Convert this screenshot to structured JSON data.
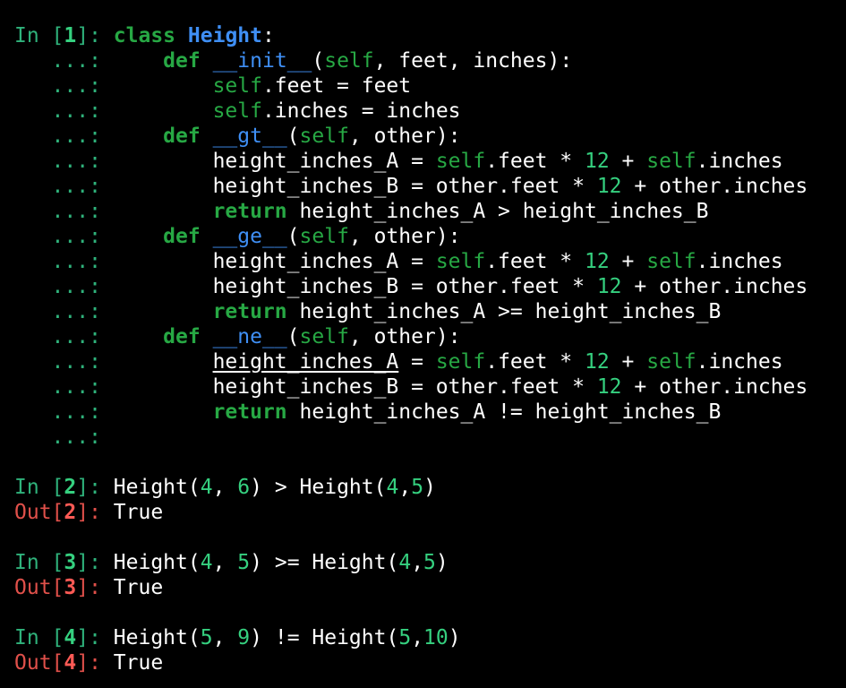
{
  "session": {
    "in_label": "In",
    "out_label": "Out",
    "continuation": "...:"
  },
  "cells": [
    {
      "number": "1",
      "input_lines": [
        {
          "indent": "",
          "tokens": [
            {
              "t": "class",
              "c": "kw"
            },
            {
              "t": " ",
              "c": "plain"
            },
            {
              "t": "Height",
              "c": "cls"
            },
            {
              "t": ":",
              "c": "plain"
            }
          ]
        },
        {
          "indent": "    ",
          "tokens": [
            {
              "t": "def",
              "c": "kw"
            },
            {
              "t": " ",
              "c": "plain"
            },
            {
              "t": "__init__",
              "c": "fn"
            },
            {
              "t": "(",
              "c": "plain"
            },
            {
              "t": "self",
              "c": "self"
            },
            {
              "t": ", feet, inches):",
              "c": "plain"
            }
          ]
        },
        {
          "indent": "        ",
          "tokens": [
            {
              "t": "self",
              "c": "self"
            },
            {
              "t": ".feet = feet",
              "c": "plain"
            }
          ]
        },
        {
          "indent": "        ",
          "tokens": [
            {
              "t": "self",
              "c": "self"
            },
            {
              "t": ".inches = inches",
              "c": "plain"
            }
          ]
        },
        {
          "indent": "    ",
          "tokens": [
            {
              "t": "def",
              "c": "kw"
            },
            {
              "t": " ",
              "c": "plain"
            },
            {
              "t": "__gt__",
              "c": "fn"
            },
            {
              "t": "(",
              "c": "plain"
            },
            {
              "t": "self",
              "c": "self"
            },
            {
              "t": ", other):",
              "c": "plain"
            }
          ]
        },
        {
          "indent": "        ",
          "tokens": [
            {
              "t": "height_inches_A = ",
              "c": "plain"
            },
            {
              "t": "self",
              "c": "self"
            },
            {
              "t": ".feet * ",
              "c": "plain"
            },
            {
              "t": "12",
              "c": "num"
            },
            {
              "t": " + ",
              "c": "plain"
            },
            {
              "t": "self",
              "c": "self"
            },
            {
              "t": ".inches",
              "c": "plain"
            }
          ]
        },
        {
          "indent": "        ",
          "tokens": [
            {
              "t": "height_inches_B = other.feet * ",
              "c": "plain"
            },
            {
              "t": "12",
              "c": "num"
            },
            {
              "t": " + other.inches",
              "c": "plain"
            }
          ]
        },
        {
          "indent": "        ",
          "tokens": [
            {
              "t": "return",
              "c": "kw"
            },
            {
              "t": " height_inches_A > height_inches_B",
              "c": "plain"
            }
          ]
        },
        {
          "indent": "    ",
          "tokens": [
            {
              "t": "def",
              "c": "kw"
            },
            {
              "t": " ",
              "c": "plain"
            },
            {
              "t": "__ge__",
              "c": "fn"
            },
            {
              "t": "(",
              "c": "plain"
            },
            {
              "t": "self",
              "c": "self"
            },
            {
              "t": ", other):",
              "c": "plain"
            }
          ]
        },
        {
          "indent": "        ",
          "tokens": [
            {
              "t": "height_inches_A = ",
              "c": "plain"
            },
            {
              "t": "self",
              "c": "self"
            },
            {
              "t": ".feet * ",
              "c": "plain"
            },
            {
              "t": "12",
              "c": "num"
            },
            {
              "t": " + ",
              "c": "plain"
            },
            {
              "t": "self",
              "c": "self"
            },
            {
              "t": ".inches",
              "c": "plain"
            }
          ]
        },
        {
          "indent": "        ",
          "tokens": [
            {
              "t": "height_inches_B = other.feet * ",
              "c": "plain"
            },
            {
              "t": "12",
              "c": "num"
            },
            {
              "t": " + other.inches",
              "c": "plain"
            }
          ]
        },
        {
          "indent": "        ",
          "tokens": [
            {
              "t": "return",
              "c": "kw"
            },
            {
              "t": " height_inches_A >= height_inches_B",
              "c": "plain"
            }
          ]
        },
        {
          "indent": "    ",
          "tokens": [
            {
              "t": "def",
              "c": "kw"
            },
            {
              "t": " ",
              "c": "plain"
            },
            {
              "t": "__ne__",
              "c": "fn"
            },
            {
              "t": "(",
              "c": "plain"
            },
            {
              "t": "self",
              "c": "self"
            },
            {
              "t": ", other):",
              "c": "plain"
            }
          ]
        },
        {
          "indent": "        ",
          "tokens": [
            {
              "t": "height_inches_A",
              "c": "underlined"
            },
            {
              "t": " = ",
              "c": "plain"
            },
            {
              "t": "self",
              "c": "self"
            },
            {
              "t": ".feet * ",
              "c": "plain"
            },
            {
              "t": "12",
              "c": "num"
            },
            {
              "t": " + ",
              "c": "plain"
            },
            {
              "t": "self",
              "c": "self"
            },
            {
              "t": ".inches",
              "c": "plain"
            }
          ]
        },
        {
          "indent": "        ",
          "tokens": [
            {
              "t": "height_inches_B = other.feet * ",
              "c": "plain"
            },
            {
              "t": "12",
              "c": "num"
            },
            {
              "t": " + other.inches",
              "c": "plain"
            }
          ]
        },
        {
          "indent": "        ",
          "tokens": [
            {
              "t": "return",
              "c": "kw"
            },
            {
              "t": " height_inches_A != height_inches_B",
              "c": "plain"
            }
          ]
        },
        {
          "indent": "",
          "tokens": []
        }
      ],
      "output": null
    },
    {
      "number": "2",
      "input_lines": [
        {
          "indent": "",
          "tokens": [
            {
              "t": "Height(",
              "c": "plain"
            },
            {
              "t": "4",
              "c": "num"
            },
            {
              "t": ", ",
              "c": "plain"
            },
            {
              "t": "6",
              "c": "num"
            },
            {
              "t": ") > Height(",
              "c": "plain"
            },
            {
              "t": "4",
              "c": "num"
            },
            {
              "t": ",",
              "c": "plain"
            },
            {
              "t": "5",
              "c": "num"
            },
            {
              "t": ")",
              "c": "plain"
            }
          ]
        }
      ],
      "output": "True"
    },
    {
      "number": "3",
      "input_lines": [
        {
          "indent": "",
          "tokens": [
            {
              "t": "Height(",
              "c": "plain"
            },
            {
              "t": "4",
              "c": "num"
            },
            {
              "t": ", ",
              "c": "plain"
            },
            {
              "t": "5",
              "c": "num"
            },
            {
              "t": ") >= Height(",
              "c": "plain"
            },
            {
              "t": "4",
              "c": "num"
            },
            {
              "t": ",",
              "c": "plain"
            },
            {
              "t": "5",
              "c": "num"
            },
            {
              "t": ")",
              "c": "plain"
            }
          ]
        }
      ],
      "output": "True"
    },
    {
      "number": "4",
      "input_lines": [
        {
          "indent": "",
          "tokens": [
            {
              "t": "Height(",
              "c": "plain"
            },
            {
              "t": "5",
              "c": "num"
            },
            {
              "t": ", ",
              "c": "plain"
            },
            {
              "t": "9",
              "c": "num"
            },
            {
              "t": ") != Height(",
              "c": "plain"
            },
            {
              "t": "5",
              "c": "num"
            },
            {
              "t": ",",
              "c": "plain"
            },
            {
              "t": "10",
              "c": "num"
            },
            {
              "t": ")",
              "c": "plain"
            }
          ]
        }
      ],
      "output": "True"
    }
  ]
}
